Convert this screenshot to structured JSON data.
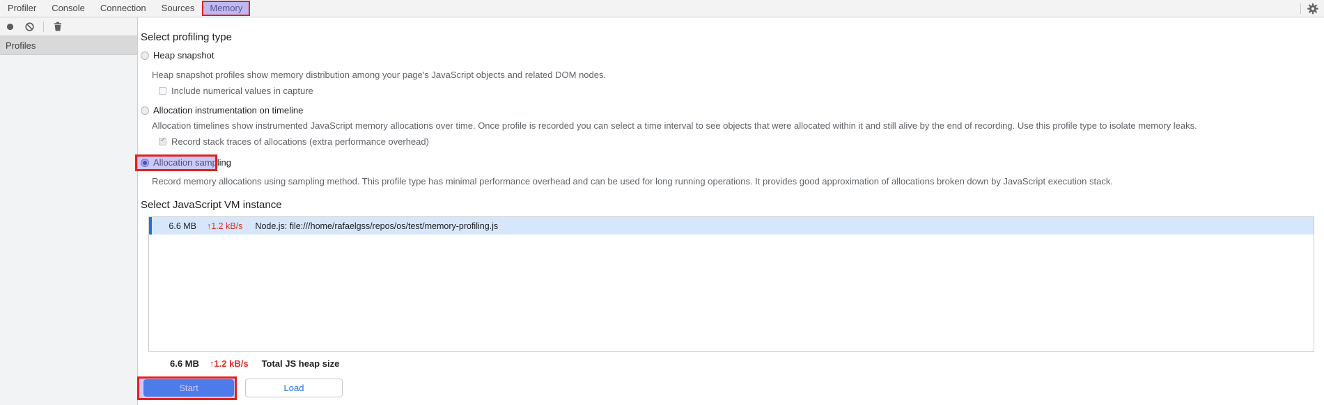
{
  "tabs": {
    "items": [
      {
        "label": "Profiler"
      },
      {
        "label": "Console"
      },
      {
        "label": "Connection"
      },
      {
        "label": "Sources"
      },
      {
        "label": "Memory"
      }
    ],
    "selected": "Memory"
  },
  "toolbar": {
    "icons": [
      "record-icon",
      "clear-icon",
      "trash-icon"
    ],
    "settings_icon": "settings-gear-icon"
  },
  "sidebar": {
    "header": "Profiles"
  },
  "profiling": {
    "heading": "Select profiling type",
    "options": [
      {
        "label": "Heap snapshot",
        "selected": false,
        "description": "Heap snapshot profiles show memory distribution among your page's JavaScript objects and related DOM nodes.",
        "checkbox": {
          "label": "Include numerical values in capture",
          "checked": false
        }
      },
      {
        "label": "Allocation instrumentation on timeline",
        "selected": false,
        "description": "Allocation timelines show instrumented JavaScript memory allocations over time. Once profile is recorded you can select a time interval to see objects that were allocated within it and still alive by the end of recording. Use this profile type to isolate memory leaks.",
        "checkbox": {
          "label": "Record stack traces of allocations (extra performance overhead)",
          "checked": true
        }
      },
      {
        "label": "Allocation sampling",
        "selected": true,
        "highlighted": true,
        "description": "Record memory allocations using sampling method. This profile type has minimal performance overhead and can be used for long running operations. It provides good approximation of allocations broken down by JavaScript execution stack."
      }
    ]
  },
  "vm": {
    "heading": "Select JavaScript VM instance",
    "instances": [
      {
        "size": "6.6 MB",
        "rate": "↑1.2 kB/s",
        "name": "Node.js: file:///home/rafaelgss/repos/os/test/memory-profiling.js",
        "selected": true
      }
    ],
    "total": {
      "size": "6.6 MB",
      "rate": "↑1.2 kB/s",
      "label": "Total JS heap size"
    }
  },
  "actions": {
    "start": "Start",
    "load": "Load"
  },
  "colors": {
    "accent_blue": "#1a73e8",
    "annotation_red": "#e0211d",
    "annotation_lavender": "rgba(143,133,238,0.45)",
    "selected_row_bg": "#d7e7fb",
    "rate_red": "#d93025",
    "panel_gray": "#f3f3f3",
    "sidebar_gray": "#f1f3f4",
    "profiles_header_gray": "#d9d9d9"
  }
}
